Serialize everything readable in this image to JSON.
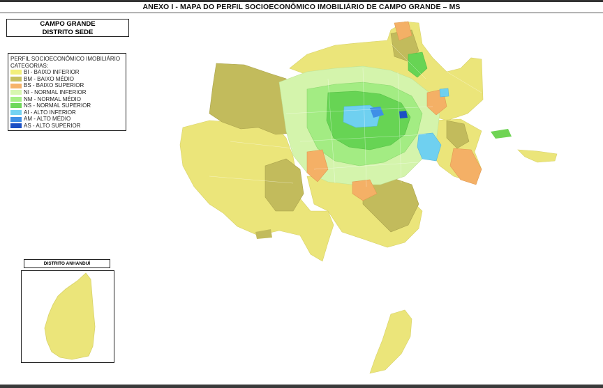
{
  "title": "ANEXO I - MAPA DO PERFIL SOCIOECONÔMICO IMOBILIÁRIO DE CAMPO GRANDE – MS",
  "place": {
    "line1": "CAMPO GRANDE",
    "line2": "DISTRITO SEDE"
  },
  "legend": {
    "title": "PERFIL SOCIOECONÔMICO IMOBILIÁRIO",
    "subtitle": "CATEGORIAS:",
    "items": [
      {
        "label": "BI - BAIXO INFERIOR",
        "color": "#f2ef7a"
      },
      {
        "label": "BM - BAIXO MÉDIO",
        "color": "#c7c05e"
      },
      {
        "label": "BS - BAIXO SUPERIOR",
        "color": "#f6b36a"
      },
      {
        "label": "NI - NORMAL INFERIOR",
        "color": "#d7f7b0"
      },
      {
        "label": "NM - NORMAL MÉDIO",
        "color": "#a6ef85"
      },
      {
        "label": "NS - NORMAL SUPERIOR",
        "color": "#6fd85a"
      },
      {
        "label": "AI - ALTO INFERIOR",
        "color": "#74d3f2"
      },
      {
        "label": "AM - ALTO MÉDIO",
        "color": "#3f8fe6"
      },
      {
        "label": "AS - ALTO SUPERIOR",
        "color": "#1c4fc4"
      }
    ]
  },
  "inset": {
    "label": "DISTRITO ANHANDUÍ"
  }
}
